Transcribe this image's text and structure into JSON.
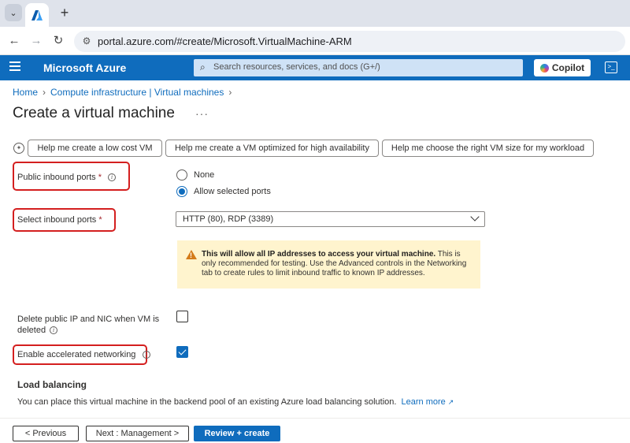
{
  "browser": {
    "url": "portal.azure.com/#create/Microsoft.VirtualMachine-ARM",
    "new_tab": "+"
  },
  "header": {
    "brand": "Microsoft Azure",
    "search_placeholder": "Search resources, services, and docs (G+/)",
    "copilot_label": "Copilot"
  },
  "breadcrumb": {
    "items": [
      "Home",
      "Compute infrastructure | Virtual machines"
    ]
  },
  "page": {
    "title": "Create a virtual machine",
    "more": "···"
  },
  "suggestions": [
    "Help me create a low cost VM",
    "Help me create a VM optimized for high availability",
    "Help me choose the right VM size for my workload"
  ],
  "form": {
    "public_inbound_ports": {
      "label": "Public inbound ports",
      "required": "*",
      "options": [
        "None",
        "Allow selected ports"
      ],
      "selected": "Allow selected ports"
    },
    "select_inbound_ports": {
      "label": "Select inbound ports",
      "required": "*",
      "value": "HTTP (80), RDP (3389)"
    },
    "warning": {
      "bold": "This will allow all IP addresses to access your virtual machine.",
      "text": "This is only recommended for testing.  Use the Advanced controls in the Networking tab to create rules to limit inbound traffic to known IP addresses."
    },
    "delete_public_ip": {
      "label_line1": "Delete public IP and NIC when VM is",
      "label_line2": "deleted",
      "checked": false
    },
    "accelerated_networking": {
      "label": "Enable accelerated networking",
      "checked": true
    }
  },
  "load_balancing": {
    "title": "Load balancing",
    "description": "You can place this virtual machine in the backend pool of an existing Azure load balancing solution.",
    "link": "Learn more"
  },
  "footer": {
    "previous": "< Previous",
    "next": "Next : Management >",
    "review": "Review + create"
  },
  "colors": {
    "azure_blue": "#0f6cbd",
    "highlight_red": "#d41f1f",
    "warning_bg": "#fff4ce"
  }
}
